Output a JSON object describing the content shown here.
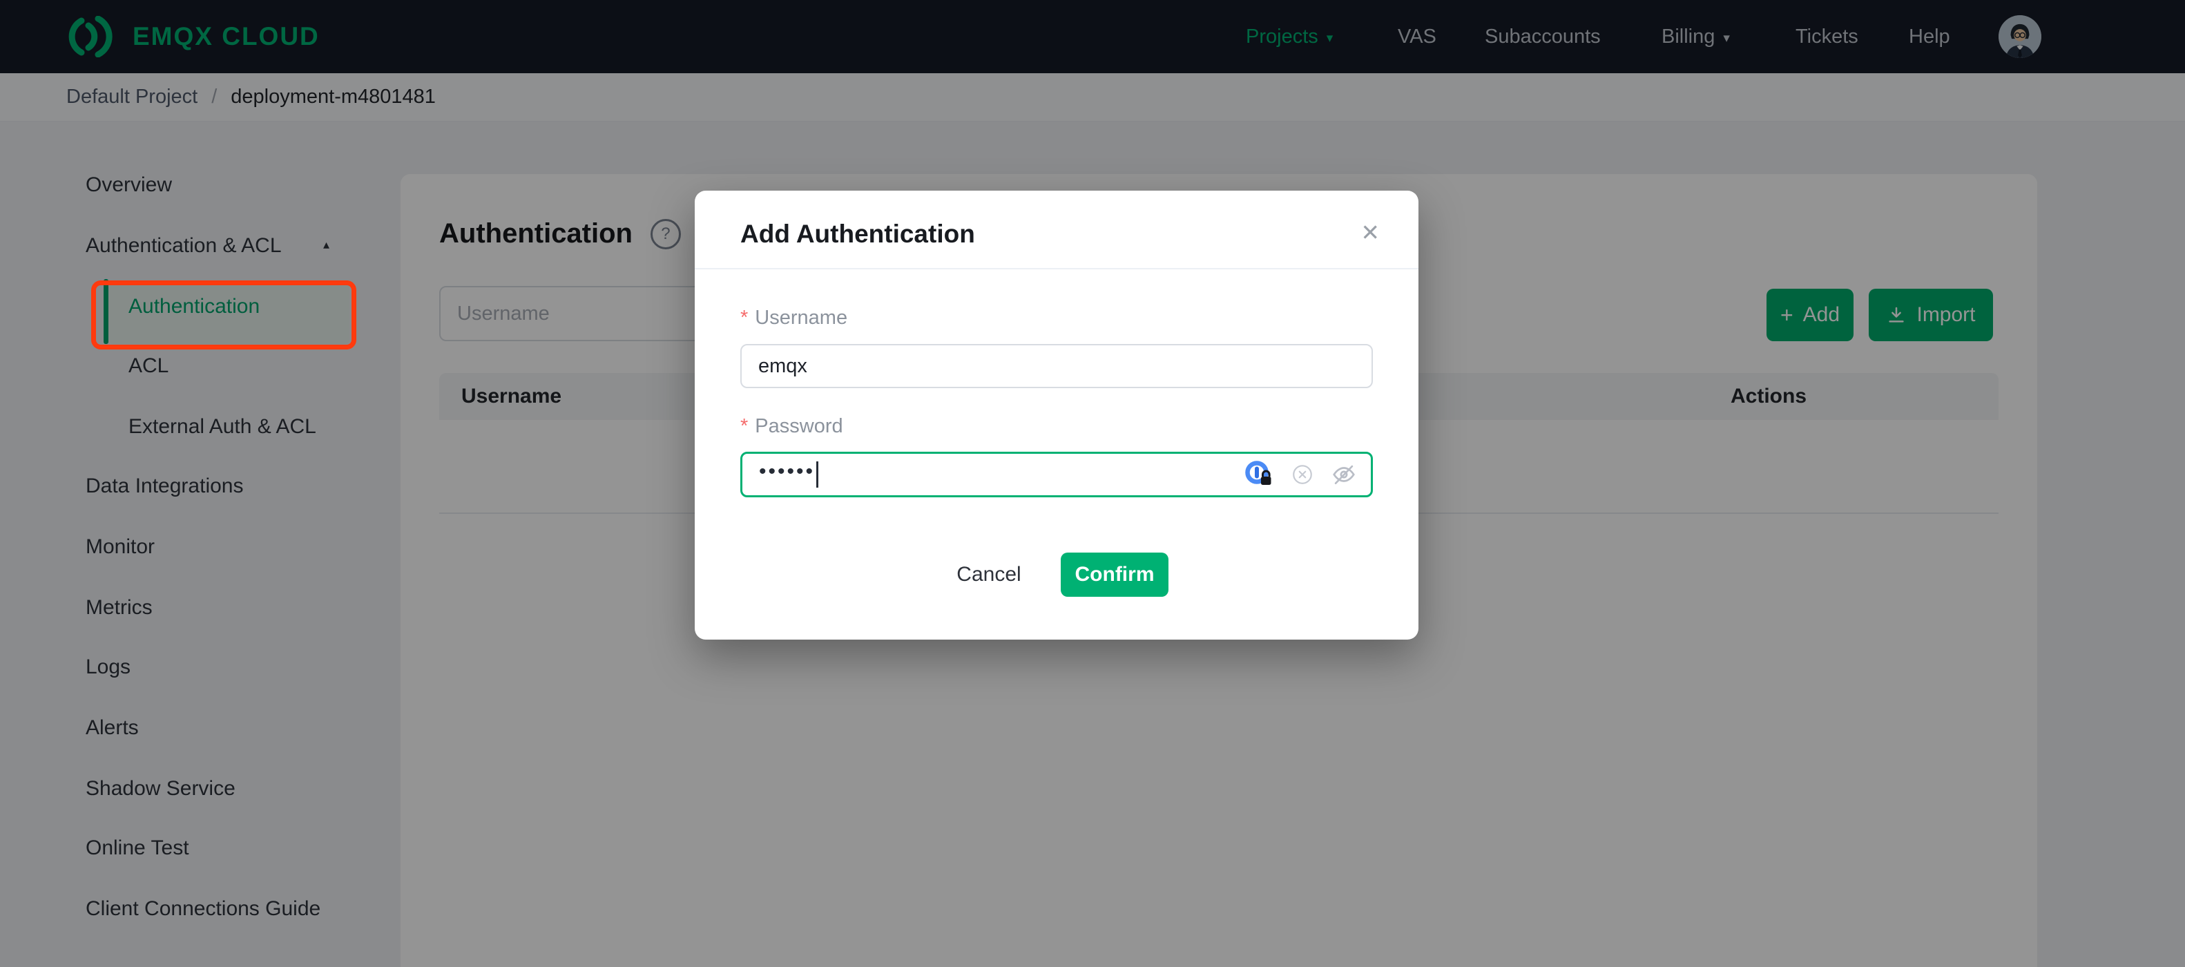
{
  "colors": {
    "accent_green": "#00b173",
    "navbar_bg": "#161b26",
    "annotation_red": "#ff3a0e",
    "required_red": "#f56c6c",
    "focus_border": "#00b173"
  },
  "navbar": {
    "logo_text": "EMQX CLOUD",
    "items": [
      {
        "label": "Projects",
        "dropdown": true,
        "active": true
      },
      {
        "label": "VAS"
      },
      {
        "label": "Subaccounts"
      },
      {
        "label": "Billing",
        "dropdown": true
      },
      {
        "label": "Tickets"
      },
      {
        "label": "Help"
      }
    ]
  },
  "breadcrumb": {
    "project": "Default Project",
    "separator": "/",
    "deployment": "deployment-m4801481"
  },
  "sidebar": {
    "items": [
      {
        "label": "Overview"
      },
      {
        "label": "Authentication & ACL",
        "expanded": true
      },
      {
        "label": "Authentication",
        "child": true,
        "active": true,
        "annotated": true
      },
      {
        "label": "ACL",
        "child": true
      },
      {
        "label": "External Auth & ACL",
        "child": true
      },
      {
        "label": "Data Integrations"
      },
      {
        "label": "Monitor"
      },
      {
        "label": "Metrics"
      },
      {
        "label": "Logs"
      },
      {
        "label": "Alerts"
      },
      {
        "label": "Shadow Service"
      },
      {
        "label": "Online Test"
      },
      {
        "label": "Client Connections Guide"
      }
    ]
  },
  "main": {
    "title": "Authentication",
    "search_placeholder": "Username",
    "add_button": "Add",
    "import_button": "Import",
    "table": {
      "columns": [
        "Username",
        "Actions"
      ],
      "rows": []
    }
  },
  "modal": {
    "title": "Add Authentication",
    "required_marker": "*",
    "username_label": "Username",
    "username_value": "emqx",
    "password_label": "Password",
    "password_masked": "••••••",
    "cancel_button": "Cancel",
    "confirm_button": "Confirm"
  },
  "icons": {
    "dropdown": "▾",
    "collapse": "▴",
    "help": "?",
    "close": "✕",
    "plus": "+",
    "logo": "emqx-arcs",
    "import": "download-arrow",
    "password_manager": "1password-lock",
    "clear": "circle-x",
    "toggle_visibility": "eye-slash"
  }
}
